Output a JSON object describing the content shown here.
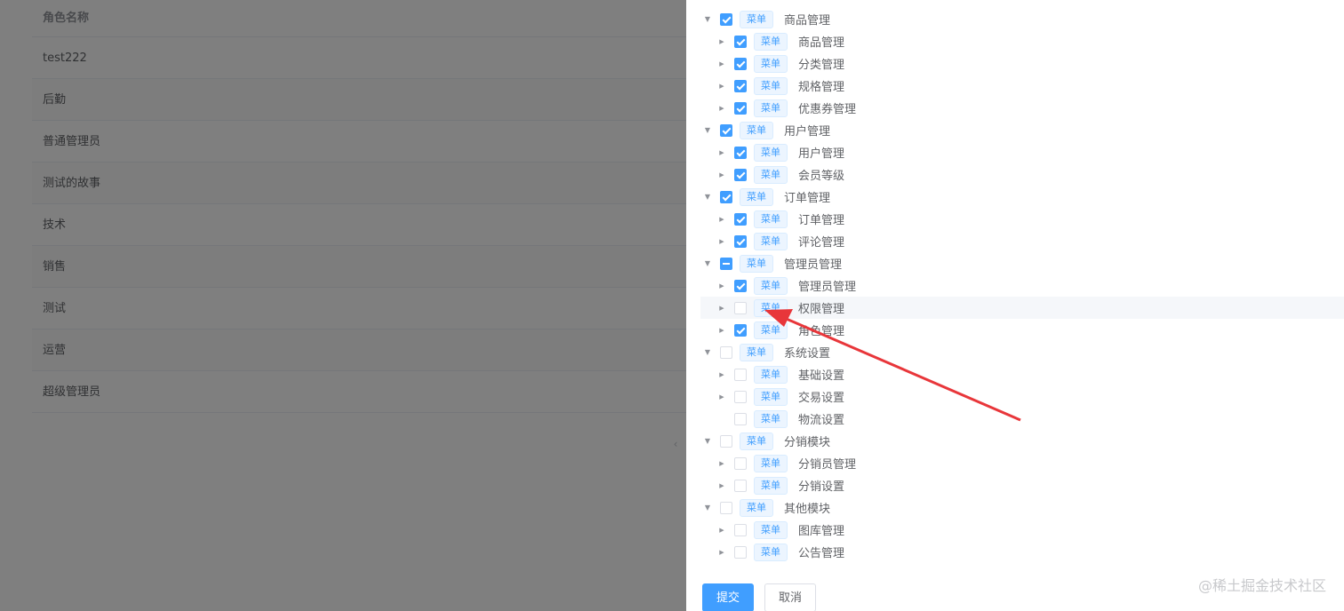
{
  "roles": {
    "header": "角色名称",
    "rows": [
      "test222",
      "后勤",
      "普通管理员",
      "测试的故事",
      "技术",
      "销售",
      "测试",
      "运营",
      "超级管理员"
    ]
  },
  "tree": [
    {
      "depth": 0,
      "caret": "expanded",
      "state": "checked",
      "tag": "菜单",
      "label": "商品管理"
    },
    {
      "depth": 1,
      "caret": "collapsed",
      "state": "checked",
      "tag": "菜单",
      "label": "商品管理"
    },
    {
      "depth": 1,
      "caret": "collapsed",
      "state": "checked",
      "tag": "菜单",
      "label": "分类管理"
    },
    {
      "depth": 1,
      "caret": "collapsed",
      "state": "checked",
      "tag": "菜单",
      "label": "规格管理"
    },
    {
      "depth": 1,
      "caret": "collapsed",
      "state": "checked",
      "tag": "菜单",
      "label": "优惠券管理"
    },
    {
      "depth": 0,
      "caret": "expanded",
      "state": "checked",
      "tag": "菜单",
      "label": "用户管理"
    },
    {
      "depth": 1,
      "caret": "collapsed",
      "state": "checked",
      "tag": "菜单",
      "label": "用户管理"
    },
    {
      "depth": 1,
      "caret": "collapsed",
      "state": "checked",
      "tag": "菜单",
      "label": "会员等级"
    },
    {
      "depth": 0,
      "caret": "expanded",
      "state": "checked",
      "tag": "菜单",
      "label": "订单管理"
    },
    {
      "depth": 1,
      "caret": "collapsed",
      "state": "checked",
      "tag": "菜单",
      "label": "订单管理"
    },
    {
      "depth": 1,
      "caret": "collapsed",
      "state": "checked",
      "tag": "菜单",
      "label": "评论管理"
    },
    {
      "depth": 0,
      "caret": "expanded",
      "state": "indeterminate",
      "tag": "菜单",
      "label": "管理员管理"
    },
    {
      "depth": 1,
      "caret": "collapsed",
      "state": "checked",
      "tag": "菜单",
      "label": "管理员管理"
    },
    {
      "depth": 1,
      "caret": "collapsed",
      "state": "unchecked",
      "tag": "菜单",
      "label": "权限管理",
      "hover": true
    },
    {
      "depth": 1,
      "caret": "collapsed",
      "state": "checked",
      "tag": "菜单",
      "label": "角色管理"
    },
    {
      "depth": 0,
      "caret": "expanded",
      "state": "unchecked",
      "tag": "菜单",
      "label": "系统设置"
    },
    {
      "depth": 1,
      "caret": "collapsed",
      "state": "unchecked",
      "tag": "菜单",
      "label": "基础设置"
    },
    {
      "depth": 1,
      "caret": "collapsed",
      "state": "unchecked",
      "tag": "菜单",
      "label": "交易设置"
    },
    {
      "depth": 1,
      "caret": "none",
      "state": "unchecked",
      "tag": "菜单",
      "label": "物流设置"
    },
    {
      "depth": 0,
      "caret": "expanded",
      "state": "unchecked",
      "tag": "菜单",
      "label": "分销模块"
    },
    {
      "depth": 1,
      "caret": "collapsed",
      "state": "unchecked",
      "tag": "菜单",
      "label": "分销员管理"
    },
    {
      "depth": 1,
      "caret": "collapsed",
      "state": "unchecked",
      "tag": "菜单",
      "label": "分销设置"
    },
    {
      "depth": 0,
      "caret": "expanded",
      "state": "unchecked",
      "tag": "菜单",
      "label": "其他模块"
    },
    {
      "depth": 1,
      "caret": "collapsed",
      "state": "unchecked",
      "tag": "菜单",
      "label": "图库管理"
    },
    {
      "depth": 1,
      "caret": "collapsed",
      "state": "unchecked",
      "tag": "菜单",
      "label": "公告管理"
    }
  ],
  "footer": {
    "submit_label": "提交",
    "cancel_label": "取消"
  },
  "watermark": "@稀土掘金技术社区",
  "colors": {
    "primary": "#409eff",
    "tag_bg": "#ecf5ff",
    "arrow": "#e8363a"
  }
}
